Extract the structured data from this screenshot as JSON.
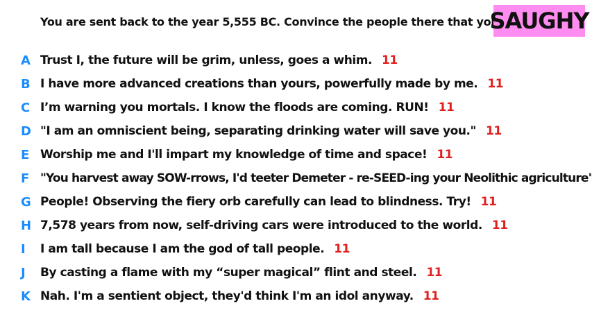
{
  "prompt": "You are sent back to the year 5,555 BC. Convince the people there that you're a god.",
  "badge": "SAUGHY",
  "colors": {
    "letter": "#1a8cff",
    "score": "#e02020",
    "badge_bg": "#ff8cf0"
  },
  "answers": [
    {
      "letter": "A",
      "text": "Trust I, the future will be grim, unless, goes a whim.",
      "score": "11"
    },
    {
      "letter": "B",
      "text": "I have more advanced creations than yours, powerfully made by me.",
      "score": "11"
    },
    {
      "letter": "C",
      "text": "I’m warning you mortals. I know the floods are coming. RUN!",
      "score": "11"
    },
    {
      "letter": "D",
      "text": "\"I am an omniscient being, separating drinking water will save you.\"",
      "score": "11"
    },
    {
      "letter": "E",
      "text": "Worship me and I'll impart my knowledge of time and space!",
      "score": "11"
    },
    {
      "letter": "F",
      "text": "\"You harvest away SOW-rrows, I'd teeter Demeter - re-SEED-ing your Neolithic agriculture\"",
      "score": "11"
    },
    {
      "letter": "G",
      "text": "People! Observing the fiery orb carefully can lead to blindness. Try!",
      "score": "11"
    },
    {
      "letter": "H",
      "text": "7,578 years from now, self-driving cars were introduced to the world.",
      "score": "11"
    },
    {
      "letter": "I",
      "text": "I am tall because I am the god of tall people.",
      "score": "11"
    },
    {
      "letter": "J",
      "text": "By casting a flame with my “super magical” flint and steel.",
      "score": "11"
    },
    {
      "letter": "K",
      "text": "Nah. I'm a sentient object, they'd think I'm an idol anyway.",
      "score": "11"
    }
  ]
}
